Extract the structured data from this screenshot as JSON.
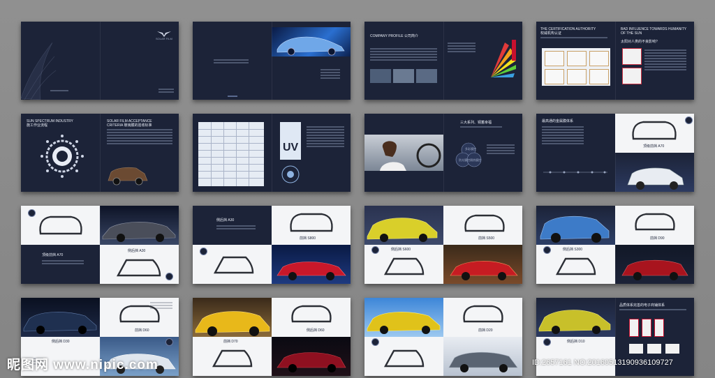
{
  "watermark": {
    "site": "昵图网 www.nipic.com",
    "id": "ID:2657161 NO:20160513190936109727"
  },
  "s1": {
    "brand": "SOLAR FILM"
  },
  "s2": {},
  "s3": {
    "title": "COMPANY PROFILE 公司简介"
  },
  "s4": {
    "t1": "THE CERTIFICATION AUTHORITY",
    "t2": "权威机构认证",
    "t3": "BAD INFLUENCE TOWARDS HUMANITY OF THE SUN",
    "t4": "太阳对人类的不良影响?"
  },
  "s5": {
    "t1": "SUN SPECTRUM INDUSTRY",
    "t2": "施工作业流程",
    "t3": "SOLAR FILM ACCEPTANCE",
    "t4": "CRITERIA 玻璃膜的验收标准"
  },
  "s6": {
    "uv": "UV"
  },
  "s7": {
    "t1": "三大系列、铜蓄幸福",
    "c1": "多彩膜控",
    "c2": "防光膜控",
    "c3": "隔热膜控"
  },
  "s8": {
    "t1": "最高通的金属膜体系",
    "p1": "顶级前挡",
    "m1": "A70"
  },
  "s9": {
    "p1": "顶级前挡",
    "m1": "A70",
    "p2": "侧后挡",
    "m2": "A30"
  },
  "s10": {
    "p1": "侧后挡",
    "m1": "A30",
    "p2": "前挡",
    "m2": "S800"
  },
  "s11": {
    "p1": "侧后挡",
    "m1": "S600",
    "p2": "前挡",
    "m2": "S500"
  },
  "s12": {
    "p1": "前挡",
    "m1": "D90",
    "p2": "侧后挡",
    "m2": "S300"
  },
  "s13": {
    "p1": "前挡",
    "m1": "D60",
    "p2": "侧后挡",
    "m2": "D30"
  },
  "s14": {
    "p1": "侧后挡",
    "m1": "D60",
    "p2": "前挡",
    "m2": "D70"
  },
  "s15": {
    "p1": "前挡",
    "m1": "D20",
    "p2": "侧后挡",
    "m2": "D70"
  },
  "s16": {
    "p1": "侧后挡",
    "m1": "D10",
    "t1": "品质体系完善的电子商铺体系"
  },
  "colors": {
    "accent": "#1c2338",
    "highlight": "#3a7bd5"
  }
}
